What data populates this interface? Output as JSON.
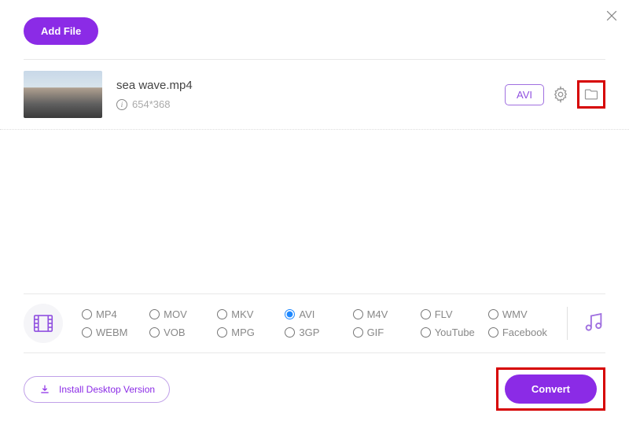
{
  "header": {
    "add_file": "Add File"
  },
  "file": {
    "name": "sea wave.mp4",
    "resolution": "654*368",
    "format_badge": "AVI"
  },
  "formats": {
    "row1": [
      "MP4",
      "MOV",
      "MKV",
      "AVI",
      "M4V",
      "FLV",
      "WMV"
    ],
    "row2": [
      "WEBM",
      "VOB",
      "MPG",
      "3GP",
      "GIF",
      "YouTube",
      "Facebook"
    ],
    "selected": "AVI"
  },
  "footer": {
    "install": "Install Desktop Version",
    "convert": "Convert"
  }
}
